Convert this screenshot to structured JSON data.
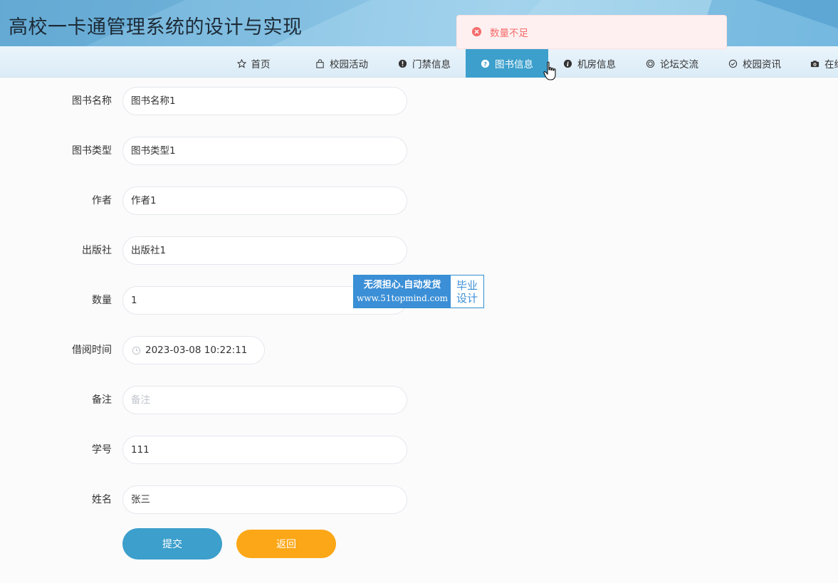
{
  "header": {
    "title": "高校一卡通管理系统的设计与实现"
  },
  "toast": {
    "message": "数量不足",
    "type": "error",
    "color": "#f56c6c"
  },
  "nav": {
    "items": [
      {
        "label": "首页",
        "icon": "star-icon"
      },
      {
        "label": "校园活动",
        "icon": "bag-icon"
      },
      {
        "label": "门禁信息",
        "icon": "alert-circle-icon"
      },
      {
        "label": "图书信息",
        "icon": "question-circle-icon",
        "active": true
      },
      {
        "label": "机房信息",
        "icon": "info-circle-icon"
      },
      {
        "label": "论坛交流",
        "icon": "ring-icon"
      },
      {
        "label": "校园资讯",
        "icon": "check-circle-icon"
      },
      {
        "label": "在线",
        "icon": "camera-icon"
      }
    ],
    "active_color": "#3c9fcc"
  },
  "form": {
    "fields": [
      {
        "label": "图书名称",
        "value": "图书名称1"
      },
      {
        "label": "图书类型",
        "value": "图书类型1"
      },
      {
        "label": "作者",
        "value": "作者1"
      },
      {
        "label": "出版社",
        "value": "出版社1"
      },
      {
        "label": "数量",
        "value": "1"
      },
      {
        "label": "借阅时间",
        "value": "2023-03-08 10:22:11"
      },
      {
        "label": "备注",
        "value": "",
        "placeholder": "备注"
      },
      {
        "label": "学号",
        "value": "111"
      },
      {
        "label": "姓名",
        "value": "张三"
      }
    ],
    "submit_label": "提交",
    "back_label": "返回",
    "submit_color": "#3c9fcc",
    "back_color": "#fba717"
  },
  "watermark": {
    "line1": "无须担心.自动发货",
    "line2": "www.51topmind.com",
    "side1": "毕业",
    "side2": "设计"
  }
}
